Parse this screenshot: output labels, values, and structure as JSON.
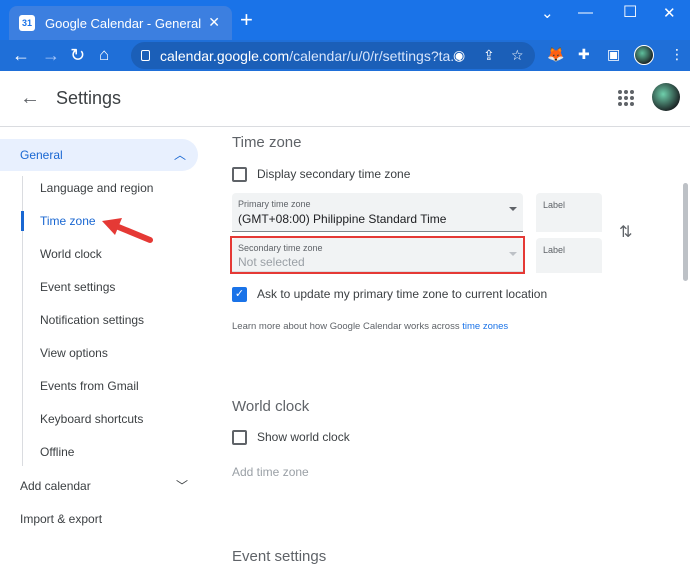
{
  "browser": {
    "tab_title": "Google Calendar - General setting",
    "favicon_text": "31",
    "url_host": "calendar.google.com",
    "url_path": "/calendar/u/0/r/settings?ta..."
  },
  "header": {
    "title": "Settings"
  },
  "sidebar": {
    "general_label": "General",
    "items": [
      {
        "label": "Language and region"
      },
      {
        "label": "Time zone"
      },
      {
        "label": "World clock"
      },
      {
        "label": "Event settings"
      },
      {
        "label": "Notification settings"
      },
      {
        "label": "View options"
      },
      {
        "label": "Events from Gmail"
      },
      {
        "label": "Keyboard shortcuts"
      },
      {
        "label": "Offline"
      }
    ],
    "active_item": "Time zone",
    "add_calendar": "Add calendar",
    "import_export": "Import & export"
  },
  "timezone": {
    "section_title": "Time zone",
    "display_secondary_label": "Display secondary time zone",
    "display_secondary_checked": false,
    "primary_label": "Primary time zone",
    "primary_value": "(GMT+08:00) Philippine Standard Time",
    "primary_label_field": "Label",
    "secondary_label": "Secondary time zone",
    "secondary_value": "Not selected",
    "secondary_label_field": "Label",
    "ask_update_label": "Ask to update my primary time zone to current location",
    "ask_update_checked": true,
    "learn_more_text": "Learn more about how Google Calendar works across ",
    "learn_more_link": "time zones"
  },
  "world_clock": {
    "section_title": "World clock",
    "show_label": "Show world clock",
    "show_checked": false,
    "add_time_zone": "Add time zone"
  },
  "event_settings": {
    "section_title": "Event settings"
  },
  "colors": {
    "browser_blue": "#1a73e8",
    "accent_blue": "#1967d2",
    "highlight_red": "#e53935"
  }
}
